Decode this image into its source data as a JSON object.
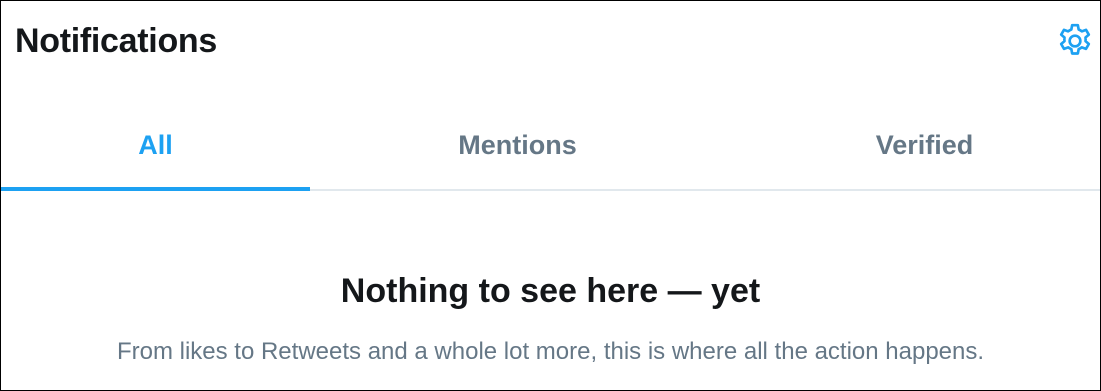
{
  "header": {
    "title": "Notifications",
    "settings_icon": "gear-icon"
  },
  "tabs": [
    {
      "label": "All",
      "active": true
    },
    {
      "label": "Mentions",
      "active": false
    },
    {
      "label": "Verified",
      "active": false
    }
  ],
  "empty_state": {
    "title": "Nothing to see here — yet",
    "subtitle": "From likes to Retweets and a whole lot more, this is where all the action happens."
  },
  "colors": {
    "accent": "#1da1f2",
    "text_primary": "#14171a",
    "text_secondary": "#657786",
    "divider": "#e1e8ed"
  }
}
